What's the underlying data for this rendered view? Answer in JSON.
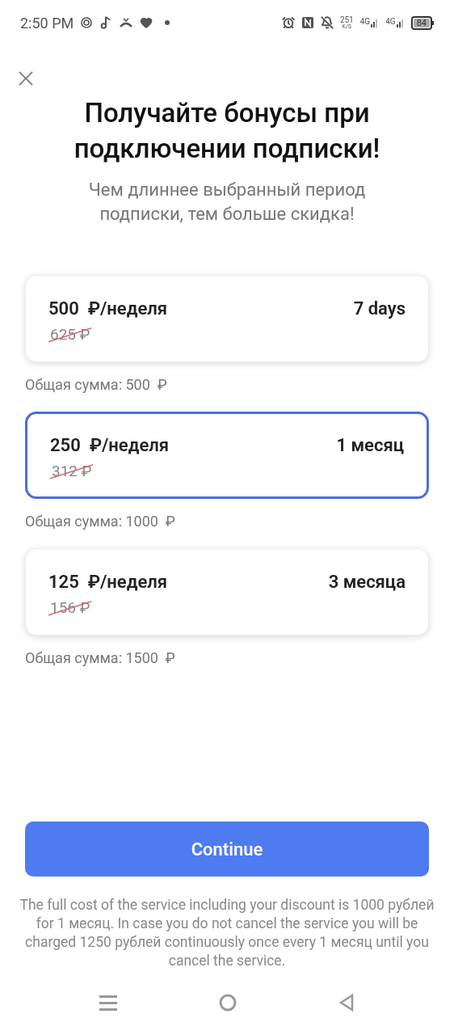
{
  "status_bar": {
    "time": "2:50 PM",
    "speed": "251",
    "speed_unit": "K/S",
    "network_1": "4G",
    "network_2": "4G",
    "battery": "84"
  },
  "title": "Получайте бонусы при подключении подписки!",
  "subtitle": "Чем длиннее выбранный период подписки, тем больше скидка!",
  "plans": [
    {
      "price": "500  ₽/неделя",
      "old_price": "625 ₽",
      "period": "7 days",
      "total": "Общая сумма: 500  ₽",
      "selected": false
    },
    {
      "price": "250  ₽/неделя",
      "old_price": "312 ₽",
      "period": "1 месяц",
      "total": "Общая сумма: 1000  ₽",
      "selected": true
    },
    {
      "price": "125  ₽/неделя",
      "old_price": "156 ₽",
      "period": "3 месяца",
      "total": "Общая сумма: 1500  ₽",
      "selected": false
    }
  ],
  "continue_button": "Continue",
  "disclaimer": "The full cost of the service including your discount is 1000 рублей for 1 месяц. In case you do not cancel the service you will be charged 1250 рублей continuously once every 1 месяц until you cancel the service."
}
